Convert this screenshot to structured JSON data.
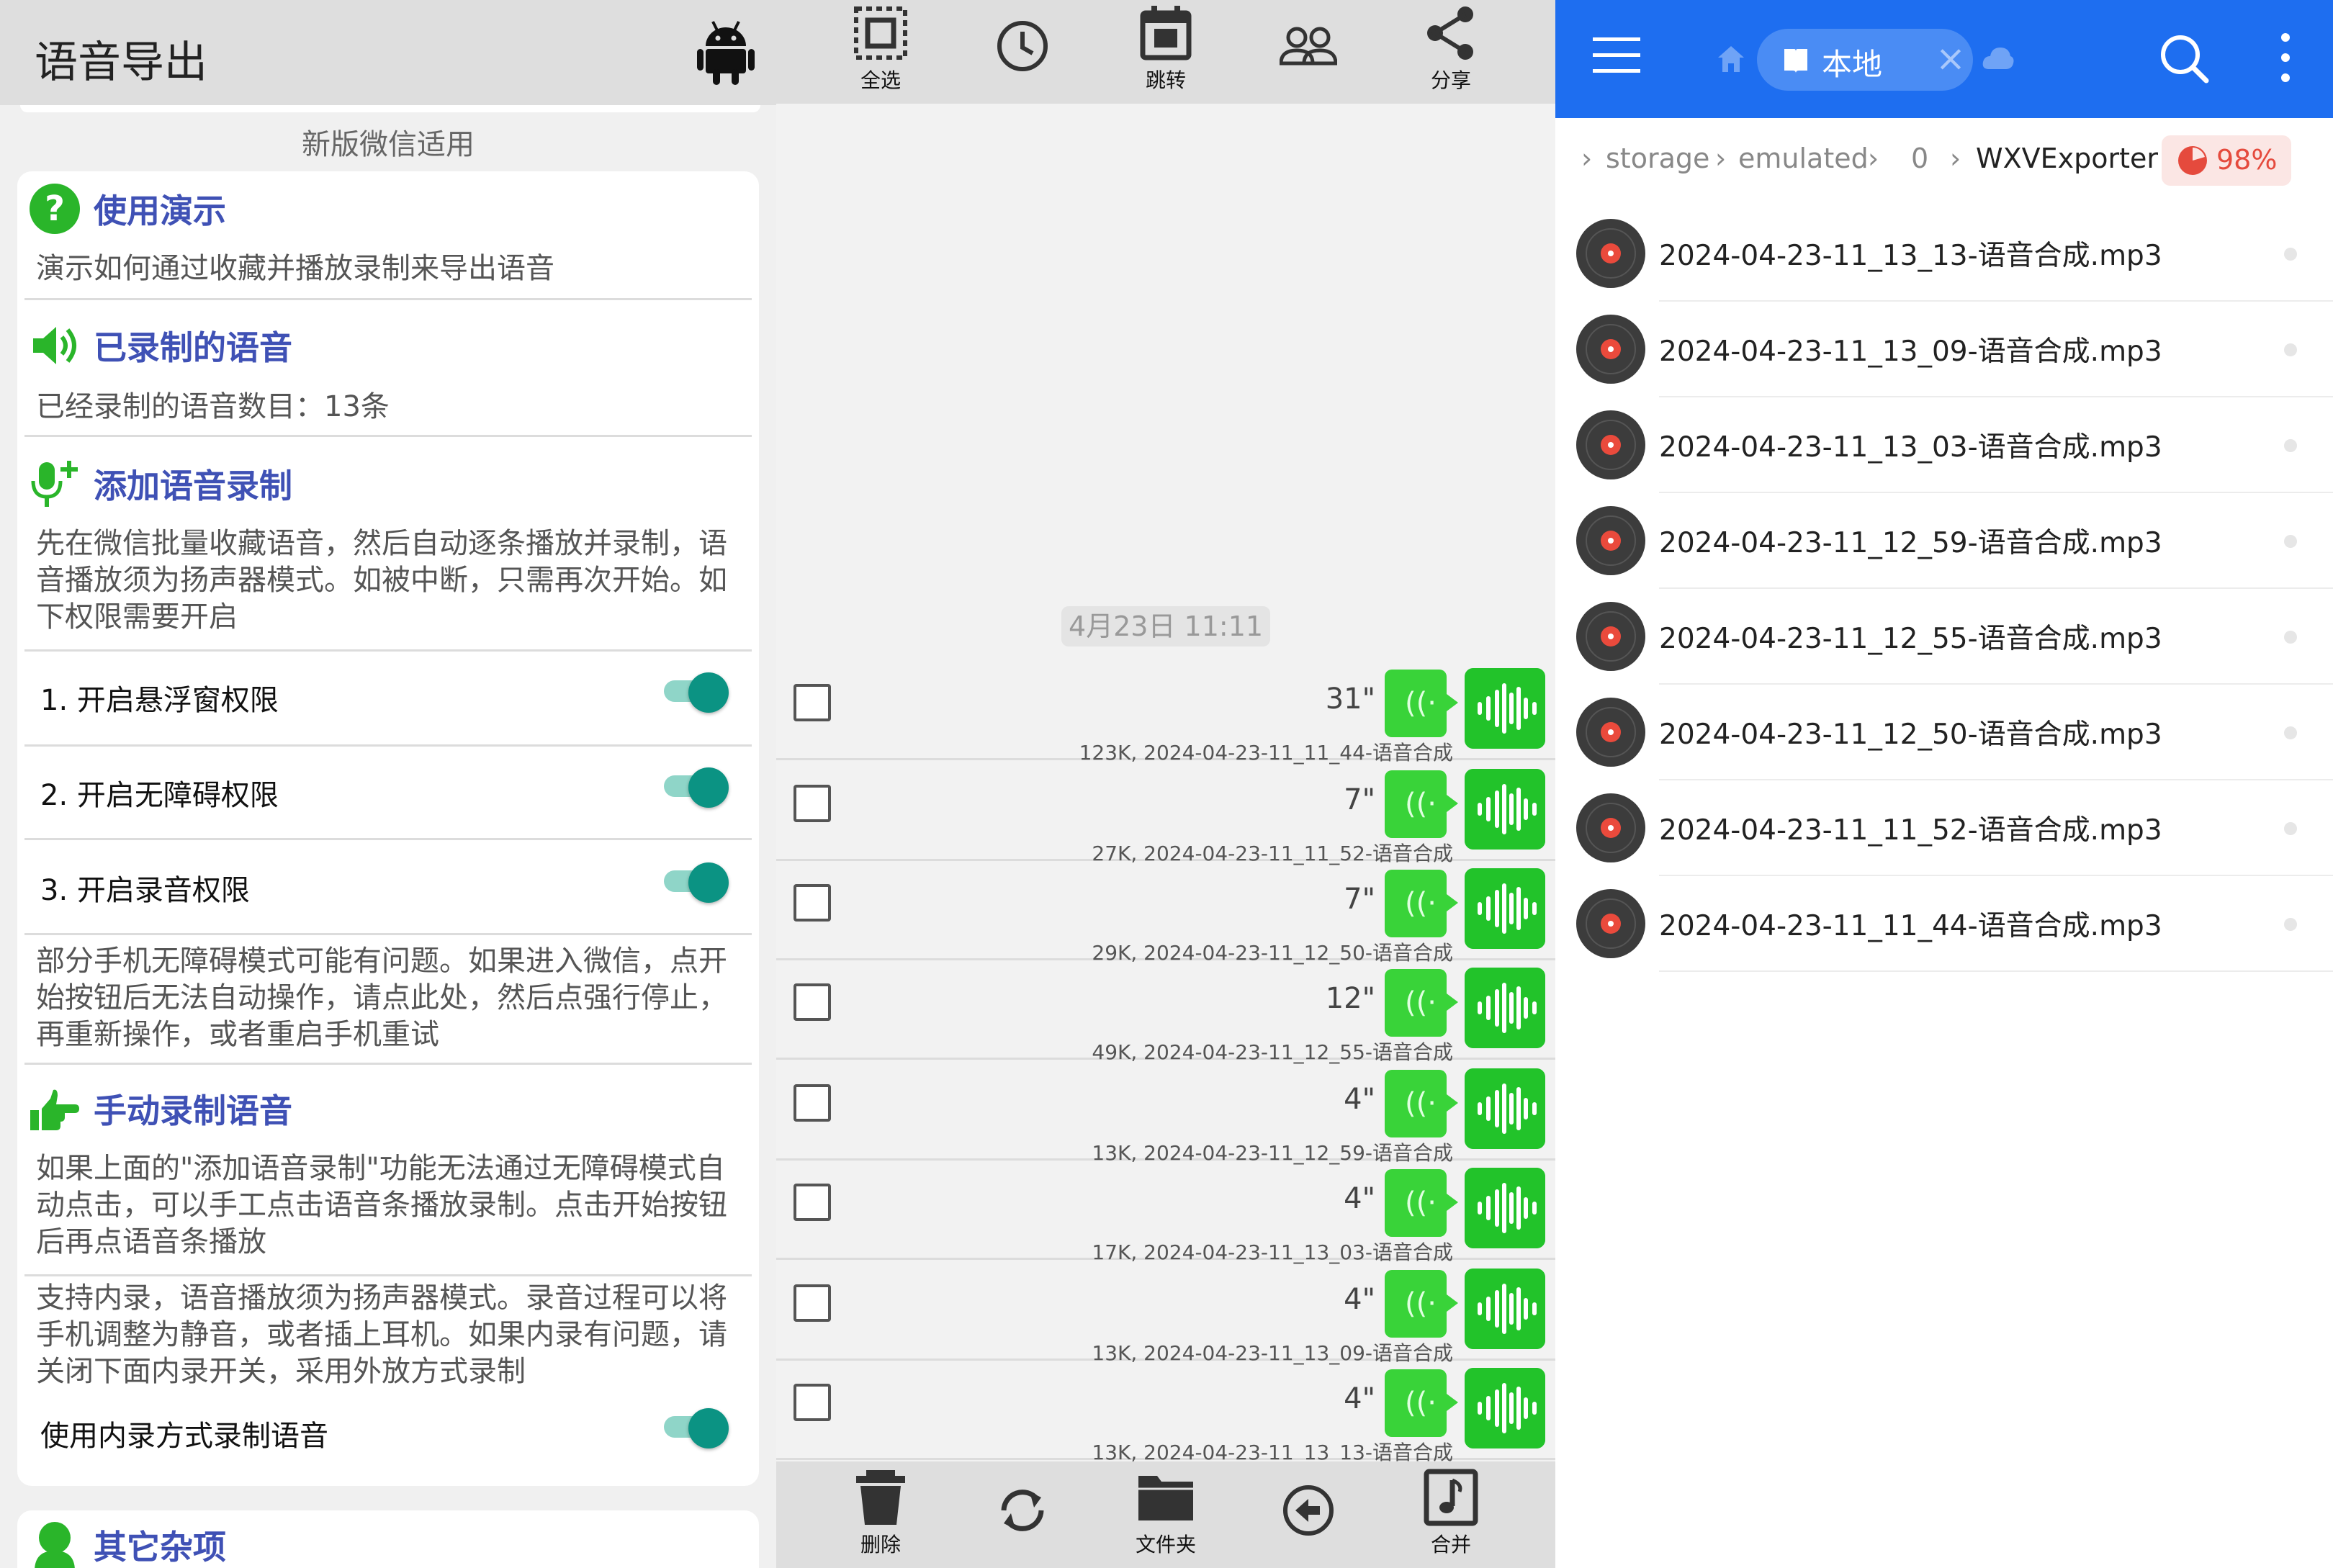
{
  "left": {
    "title": "语音导出",
    "icon": "android-icon",
    "note": "新版微信适用",
    "demo": {
      "title": "使用演示",
      "desc": "演示如何通过收藏并播放录制来导出语音",
      "icon": "help-icon"
    },
    "recorded": {
      "title": "已录制的语音",
      "desc": "已经录制的语音数目：13条",
      "icon": "speaker-icon"
    },
    "add": {
      "title": "添加语音录制",
      "icon": "mic-add-icon",
      "desc_lines": [
        "先在微信批量收藏语音，然后自动逐条播放并录制，语",
        "音播放须为扬声器模式。如被中断，只需再次开始。如",
        "下权限需要开启"
      ],
      "permissions": [
        {
          "label": "1. 开启悬浮窗权限",
          "on": true
        },
        {
          "label": "2. 开启无障碍权限",
          "on": true
        },
        {
          "label": "3. 开启录音权限",
          "on": true
        }
      ],
      "warning_lines": [
        "部分手机无障碍模式可能有问题。如果进入微信，点开",
        "始按钮后无法自动操作，请点此处，然后点强行停止，",
        "再重新操作，或者重启手机重试"
      ]
    },
    "manual": {
      "title": "手动录制语音",
      "icon": "hand-point-icon",
      "desc_lines": [
        "如果上面的\"添加语音录制\"功能无法通过无障碍模式自",
        "动点击，可以手工点击语音条播放录制。点击开始按钮",
        "后再点语音条播放"
      ],
      "internal_lines": [
        "支持内录，语音播放须为扬声器模式。录音过程可以将",
        "手机调整为静音，或者插上耳机。如果内录有问题，请",
        "关闭下面内录开关，采用外放方式录制"
      ],
      "internal_toggle": {
        "label": "使用内录方式录制语音",
        "on": true
      }
    },
    "other": {
      "title": "其它杂项",
      "icon": "person-icon"
    }
  },
  "middle": {
    "toolbar": [
      {
        "label": "全选",
        "icon": "select-all-icon"
      },
      {
        "label": "",
        "icon": "clock-icon"
      },
      {
        "label": "跳转",
        "icon": "calendar-icon"
      },
      {
        "label": "",
        "icon": "group-icon"
      },
      {
        "label": "分享",
        "icon": "share-icon"
      }
    ],
    "date_label": "4月23日 11:11",
    "items": [
      {
        "duration": "31\"",
        "meta": "123K, 2024-04-23-11_11_44-语音合成"
      },
      {
        "duration": "7\"",
        "meta": "27K, 2024-04-23-11_11_52-语音合成"
      },
      {
        "duration": "7\"",
        "meta": "29K, 2024-04-23-11_12_50-语音合成"
      },
      {
        "duration": "12\"",
        "meta": "49K, 2024-04-23-11_12_55-语音合成"
      },
      {
        "duration": "4\"",
        "meta": "13K, 2024-04-23-11_12_59-语音合成"
      },
      {
        "duration": "4\"",
        "meta": "17K, 2024-04-23-11_13_03-语音合成"
      },
      {
        "duration": "4\"",
        "meta": "13K, 2024-04-23-11_13_09-语音合成"
      },
      {
        "duration": "4\"",
        "meta": "13K, 2024-04-23-11_13_13-语音合成"
      }
    ],
    "bottombar": [
      {
        "label": "删除",
        "icon": "trash-icon"
      },
      {
        "label": "",
        "icon": "refresh-icon"
      },
      {
        "label": "文件夹",
        "icon": "folder-icon"
      },
      {
        "label": "",
        "icon": "back-circle-icon"
      },
      {
        "label": "合并",
        "icon": "music-note-icon"
      }
    ]
  },
  "right": {
    "tab_label": "本地",
    "breadcrumb": [
      "storage",
      "emulated",
      "0",
      "WXVExporter"
    ],
    "storage_percent": "98%",
    "files": [
      "2024-04-23-11_13_13-语音合成.mp3",
      "2024-04-23-11_13_09-语音合成.mp3",
      "2024-04-23-11_13_03-语音合成.mp3",
      "2024-04-23-11_12_59-语音合成.mp3",
      "2024-04-23-11_12_55-语音合成.mp3",
      "2024-04-23-11_12_50-语音合成.mp3",
      "2024-04-23-11_11_52-语音合成.mp3",
      "2024-04-23-11_11_44-语音合成.mp3"
    ]
  },
  "colors": {
    "accent_blue": "#1e6ef0",
    "heading": "#3f51b5",
    "toggle": "#0b9383",
    "green": "#22c32a",
    "storage_red": "#e54a3d"
  }
}
